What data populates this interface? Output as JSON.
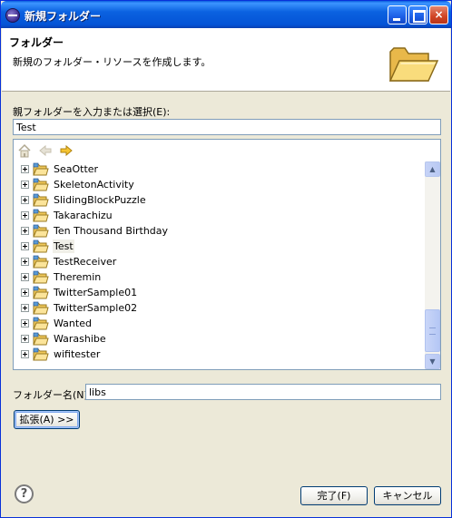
{
  "window": {
    "title": "新規フォルダー",
    "controls": {
      "minimize": "minimize",
      "maximize": "maximize",
      "close": "×"
    }
  },
  "banner": {
    "title": "フォルダー",
    "description": "新規のフォルダー・リソースを作成します。",
    "icon": "open-folder-icon"
  },
  "parent_folder": {
    "label": "親フォルダーを入力または選択(E):",
    "value": "Test"
  },
  "tree": {
    "toolbar": [
      "home-icon",
      "back-arrow-icon",
      "forward-arrow-icon"
    ],
    "items": [
      {
        "label": "SeaOtter"
      },
      {
        "label": "SkeletonActivity"
      },
      {
        "label": "SlidingBlockPuzzle"
      },
      {
        "label": "Takarachizu"
      },
      {
        "label": "Ten Thousand Birthday"
      },
      {
        "label": "Test",
        "selected": true
      },
      {
        "label": "TestReceiver"
      },
      {
        "label": "Theremin"
      },
      {
        "label": "TwitterSample01"
      },
      {
        "label": "TwitterSample02"
      },
      {
        "label": "Wanted"
      },
      {
        "label": "Warashibe"
      },
      {
        "label": "wifitester"
      }
    ],
    "scrollbar": {
      "up": "▲",
      "down": "▼"
    }
  },
  "folder_name": {
    "label": "フォルダー名(N):",
    "value": "libs"
  },
  "advanced_button": "拡張(A) >>",
  "footer": {
    "help": "?",
    "finish_button": "完了(F)",
    "cancel_button": "キャンセル"
  },
  "colors": {
    "titlebar": "#0453d6",
    "dialog_bg": "#ece9d8",
    "border_blue": "#7f9db9"
  }
}
